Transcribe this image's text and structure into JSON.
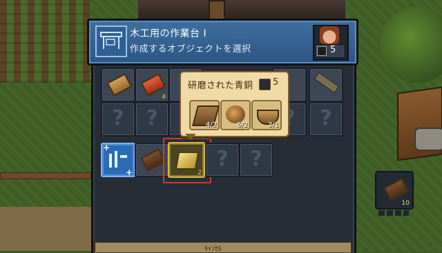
{
  "window": {
    "title": "木工用の作業台 I",
    "subtitle": "作成するオブジェクトを選択",
    "level_value": "5"
  },
  "grid": {
    "row1": [
      {
        "item": "wooden-plank",
        "qty": ""
      },
      {
        "item": "red-plank",
        "qty": "4"
      },
      {
        "item": "hidden",
        "qty": ""
      },
      {
        "item": "hidden",
        "qty": ""
      },
      {
        "item": "hidden",
        "qty": ""
      },
      {
        "item": "saw",
        "qty": ""
      }
    ],
    "row3": [
      {
        "item": "blueprint",
        "qty": ""
      },
      {
        "item": "dark-planks",
        "qty": ""
      },
      {
        "item": "polished-bronze",
        "qty": "2"
      },
      {
        "item": "unknown",
        "qty": ""
      },
      {
        "item": "unknown",
        "qty": ""
      }
    ]
  },
  "tooltip": {
    "title": "研磨された青銅",
    "cost": "5",
    "ingredients": [
      {
        "icon": "wooden-tool",
        "qty": "4/2"
      },
      {
        "icon": "bronze-ore",
        "qty": "6/2"
      },
      {
        "icon": "bowl",
        "qty": "3/1"
      }
    ]
  },
  "side_slot": {
    "qty": "10"
  },
  "bottom_label": "ｷｬﾝｾﾙ",
  "colors": {
    "header": "#3a6a9c",
    "panel": "#262d36",
    "tooltip": "#f0dba7",
    "selection": "#d33a2b"
  }
}
